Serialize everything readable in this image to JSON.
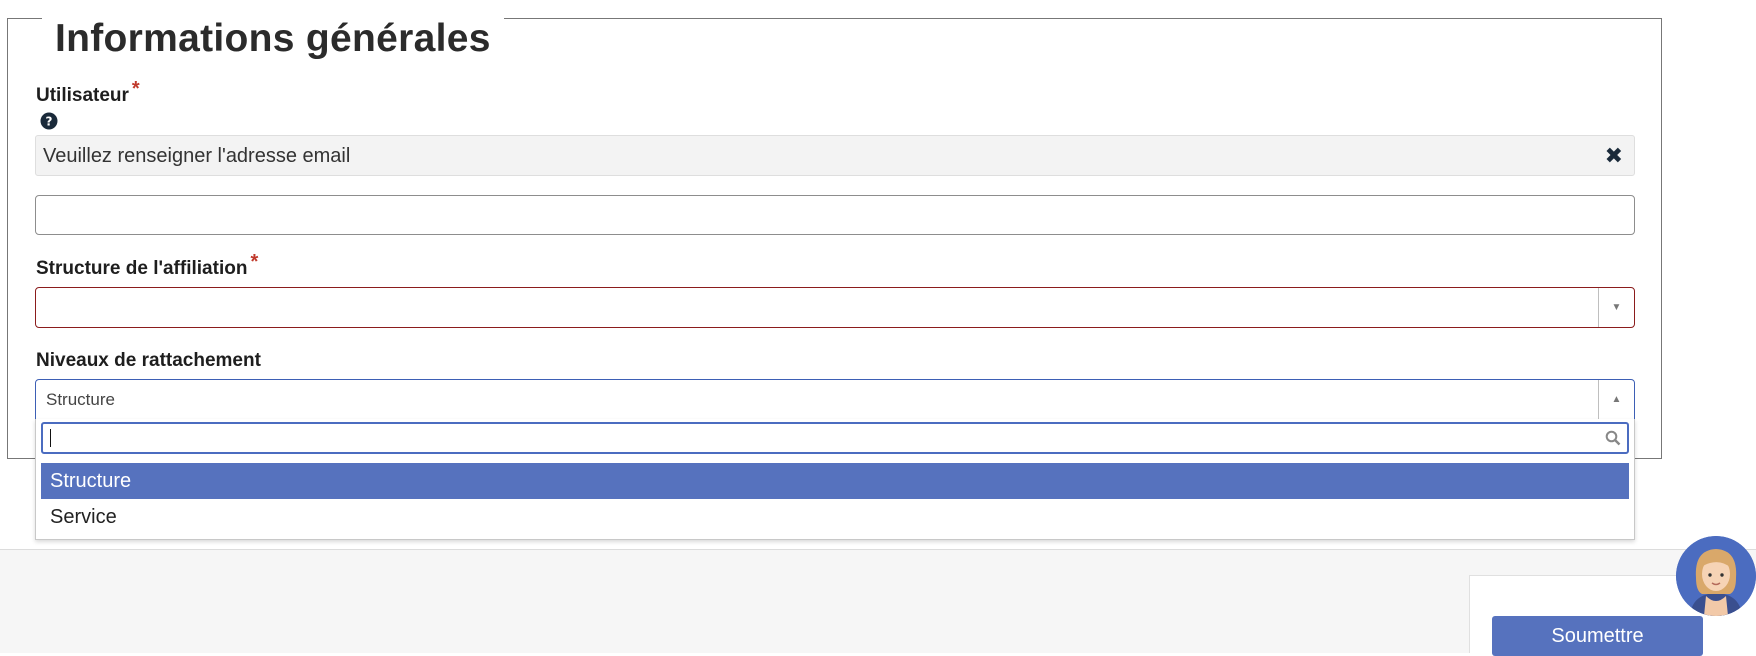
{
  "form": {
    "legend": "Informations générales",
    "required_mark": "*",
    "utilisateur": {
      "label": "Utilisateur",
      "prefilled_text": "Veuillez renseigner l'adresse email",
      "clear_icon": "close-icon",
      "email_value": ""
    },
    "affiliation": {
      "label": "Structure de l'affiliation",
      "selected": ""
    },
    "niveaux": {
      "label": "Niveaux de rattachement",
      "selected": "Structure",
      "search_value": "",
      "options": [
        "Structure",
        "Service"
      ]
    }
  },
  "actions": {
    "submit_label": "Soumettre"
  },
  "colors": {
    "accent": "#5672be",
    "required": "#c0392b",
    "error_border": "#8b1c1c"
  }
}
